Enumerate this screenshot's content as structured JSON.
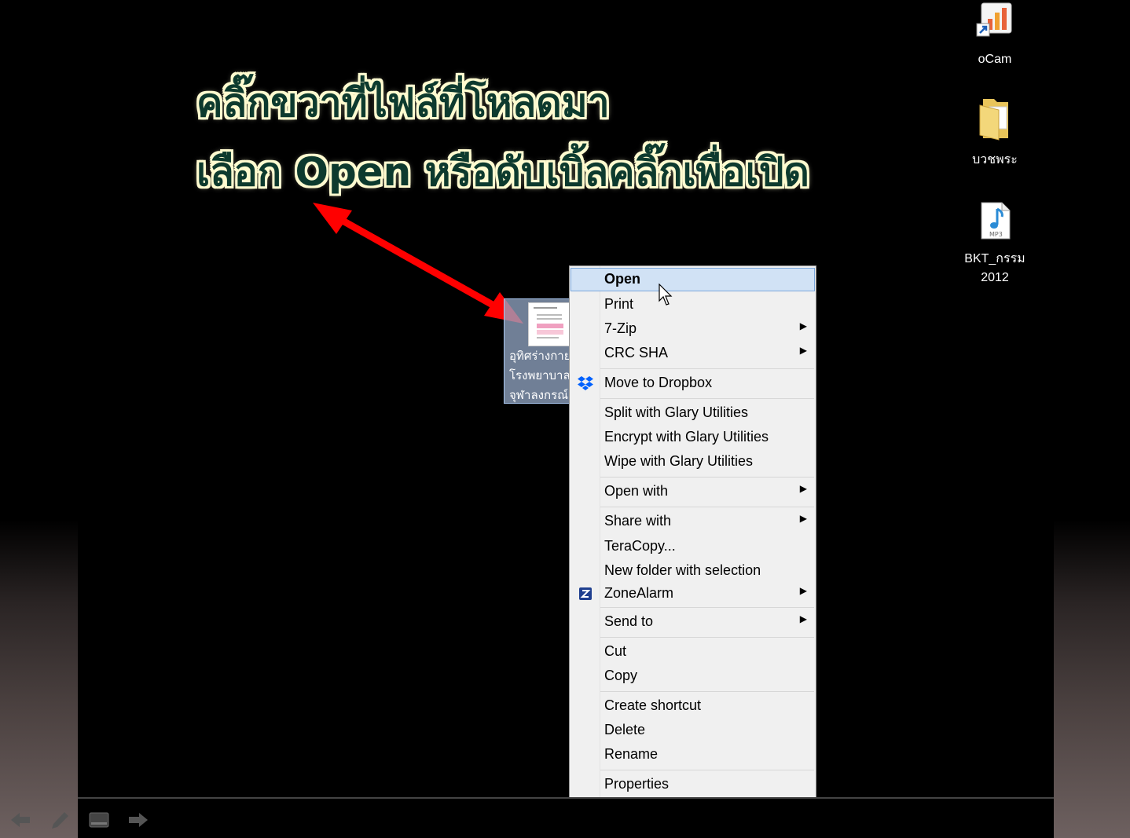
{
  "instruction": {
    "line1": "คลิ๊กขวาที่ไฟล์ที่โหลดมา",
    "line2": "เลือก Open หรือดับเบิ้ลคลิ๊กเพื่อเปิด"
  },
  "desktop_icons": [
    {
      "label": "oCam",
      "icon": "ocam-shortcut-icon"
    },
    {
      "label": "บวชพระ",
      "icon": "folder-icon"
    },
    {
      "label_line1": "BKT_กรรม",
      "label_line2": "2012",
      "icon": "mp3-file-icon"
    }
  ],
  "selected_file": {
    "line1": "อุทิศร่างกาย",
    "line2": "โรงพยาบาล",
    "line3": "จุฬาลงกรณ์"
  },
  "context_menu": {
    "items": [
      {
        "label": "Open",
        "highlighted": true
      },
      {
        "label": "Print"
      },
      {
        "label": "7-Zip",
        "submenu": true
      },
      {
        "label": "CRC SHA",
        "submenu": true
      },
      {
        "label": "Move to Dropbox",
        "icon": "dropbox-icon"
      },
      {
        "label": "Split with Glary Utilities"
      },
      {
        "label": "Encrypt with Glary Utilities"
      },
      {
        "label": "Wipe with Glary Utilities"
      },
      {
        "label": "Open with",
        "submenu": true
      },
      {
        "label": "Share with",
        "submenu": true
      },
      {
        "label": "TeraCopy..."
      },
      {
        "label": "New folder with selection"
      },
      {
        "label": "ZoneAlarm",
        "submenu": true,
        "icon": "zonealarm-icon"
      },
      {
        "label": "Send to",
        "submenu": true
      },
      {
        "label": "Cut"
      },
      {
        "label": "Copy"
      },
      {
        "label": "Create shortcut"
      },
      {
        "label": "Delete"
      },
      {
        "label": "Rename"
      },
      {
        "label": "Properties"
      }
    ],
    "submenu_glyph": "▶"
  },
  "colors": {
    "instruction_text": "#0d3a2e",
    "instruction_outline": "#fffbd0",
    "arrow": "#ff0000",
    "menu_highlight": "#d1e2f5"
  }
}
